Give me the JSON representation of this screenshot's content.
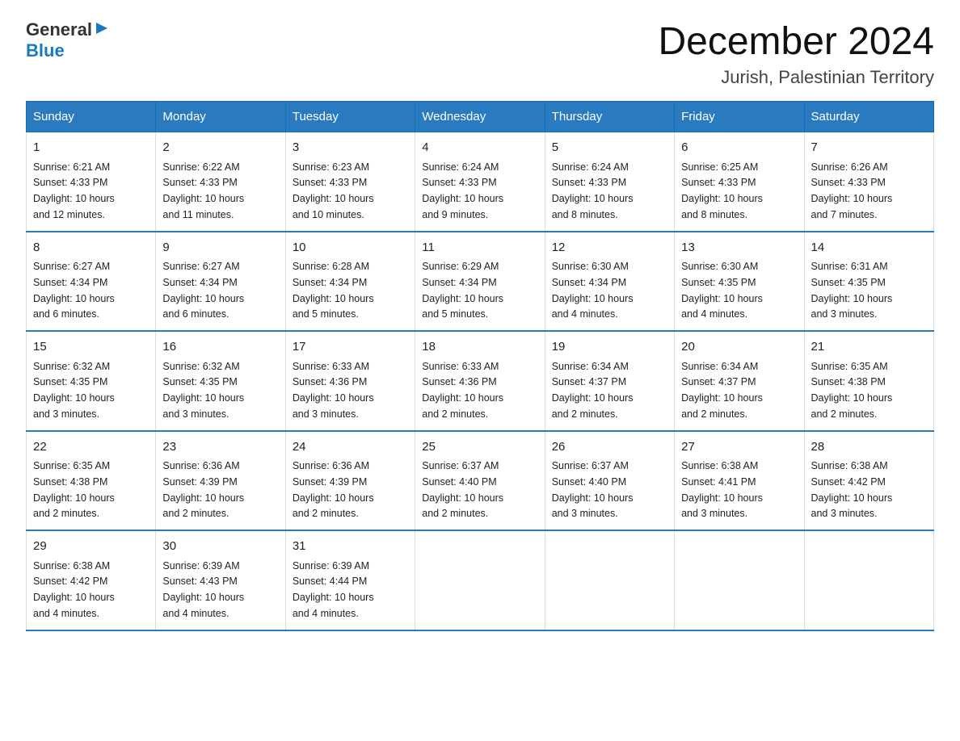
{
  "header": {
    "logo_general": "General",
    "logo_blue": "Blue",
    "title": "December 2024",
    "subtitle": "Jurish, Palestinian Territory"
  },
  "columns": [
    "Sunday",
    "Monday",
    "Tuesday",
    "Wednesday",
    "Thursday",
    "Friday",
    "Saturday"
  ],
  "weeks": [
    [
      {
        "day": "1",
        "sunrise": "6:21 AM",
        "sunset": "4:33 PM",
        "daylight": "10 hours and 12 minutes."
      },
      {
        "day": "2",
        "sunrise": "6:22 AM",
        "sunset": "4:33 PM",
        "daylight": "10 hours and 11 minutes."
      },
      {
        "day": "3",
        "sunrise": "6:23 AM",
        "sunset": "4:33 PM",
        "daylight": "10 hours and 10 minutes."
      },
      {
        "day": "4",
        "sunrise": "6:24 AM",
        "sunset": "4:33 PM",
        "daylight": "10 hours and 9 minutes."
      },
      {
        "day": "5",
        "sunrise": "6:24 AM",
        "sunset": "4:33 PM",
        "daylight": "10 hours and 8 minutes."
      },
      {
        "day": "6",
        "sunrise": "6:25 AM",
        "sunset": "4:33 PM",
        "daylight": "10 hours and 8 minutes."
      },
      {
        "day": "7",
        "sunrise": "6:26 AM",
        "sunset": "4:33 PM",
        "daylight": "10 hours and 7 minutes."
      }
    ],
    [
      {
        "day": "8",
        "sunrise": "6:27 AM",
        "sunset": "4:34 PM",
        "daylight": "10 hours and 6 minutes."
      },
      {
        "day": "9",
        "sunrise": "6:27 AM",
        "sunset": "4:34 PM",
        "daylight": "10 hours and 6 minutes."
      },
      {
        "day": "10",
        "sunrise": "6:28 AM",
        "sunset": "4:34 PM",
        "daylight": "10 hours and 5 minutes."
      },
      {
        "day": "11",
        "sunrise": "6:29 AM",
        "sunset": "4:34 PM",
        "daylight": "10 hours and 5 minutes."
      },
      {
        "day": "12",
        "sunrise": "6:30 AM",
        "sunset": "4:34 PM",
        "daylight": "10 hours and 4 minutes."
      },
      {
        "day": "13",
        "sunrise": "6:30 AM",
        "sunset": "4:35 PM",
        "daylight": "10 hours and 4 minutes."
      },
      {
        "day": "14",
        "sunrise": "6:31 AM",
        "sunset": "4:35 PM",
        "daylight": "10 hours and 3 minutes."
      }
    ],
    [
      {
        "day": "15",
        "sunrise": "6:32 AM",
        "sunset": "4:35 PM",
        "daylight": "10 hours and 3 minutes."
      },
      {
        "day": "16",
        "sunrise": "6:32 AM",
        "sunset": "4:35 PM",
        "daylight": "10 hours and 3 minutes."
      },
      {
        "day": "17",
        "sunrise": "6:33 AM",
        "sunset": "4:36 PM",
        "daylight": "10 hours and 3 minutes."
      },
      {
        "day": "18",
        "sunrise": "6:33 AM",
        "sunset": "4:36 PM",
        "daylight": "10 hours and 2 minutes."
      },
      {
        "day": "19",
        "sunrise": "6:34 AM",
        "sunset": "4:37 PM",
        "daylight": "10 hours and 2 minutes."
      },
      {
        "day": "20",
        "sunrise": "6:34 AM",
        "sunset": "4:37 PM",
        "daylight": "10 hours and 2 minutes."
      },
      {
        "day": "21",
        "sunrise": "6:35 AM",
        "sunset": "4:38 PM",
        "daylight": "10 hours and 2 minutes."
      }
    ],
    [
      {
        "day": "22",
        "sunrise": "6:35 AM",
        "sunset": "4:38 PM",
        "daylight": "10 hours and 2 minutes."
      },
      {
        "day": "23",
        "sunrise": "6:36 AM",
        "sunset": "4:39 PM",
        "daylight": "10 hours and 2 minutes."
      },
      {
        "day": "24",
        "sunrise": "6:36 AM",
        "sunset": "4:39 PM",
        "daylight": "10 hours and 2 minutes."
      },
      {
        "day": "25",
        "sunrise": "6:37 AM",
        "sunset": "4:40 PM",
        "daylight": "10 hours and 2 minutes."
      },
      {
        "day": "26",
        "sunrise": "6:37 AM",
        "sunset": "4:40 PM",
        "daylight": "10 hours and 3 minutes."
      },
      {
        "day": "27",
        "sunrise": "6:38 AM",
        "sunset": "4:41 PM",
        "daylight": "10 hours and 3 minutes."
      },
      {
        "day": "28",
        "sunrise": "6:38 AM",
        "sunset": "4:42 PM",
        "daylight": "10 hours and 3 minutes."
      }
    ],
    [
      {
        "day": "29",
        "sunrise": "6:38 AM",
        "sunset": "4:42 PM",
        "daylight": "10 hours and 4 minutes."
      },
      {
        "day": "30",
        "sunrise": "6:39 AM",
        "sunset": "4:43 PM",
        "daylight": "10 hours and 4 minutes."
      },
      {
        "day": "31",
        "sunrise": "6:39 AM",
        "sunset": "4:44 PM",
        "daylight": "10 hours and 4 minutes."
      },
      null,
      null,
      null,
      null
    ]
  ],
  "labels": {
    "sunrise": "Sunrise:",
    "sunset": "Sunset:",
    "daylight": "Daylight:"
  }
}
